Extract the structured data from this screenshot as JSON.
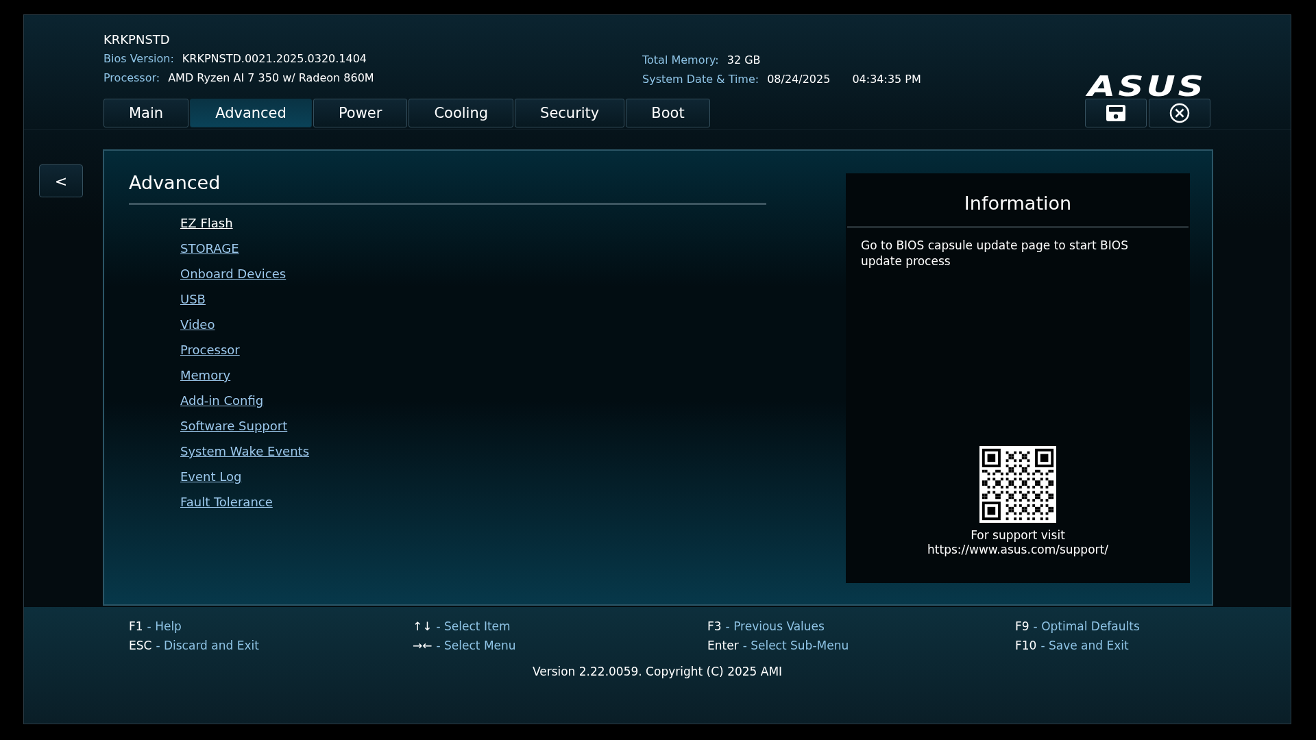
{
  "header": {
    "model": "KRKPNSTD",
    "info_left": [
      {
        "label": "Bios Version:",
        "value": "KRKPNSTD.0021.2025.0320.1404"
      },
      {
        "label": "Processor:",
        "value": "AMD Ryzen AI 7 350 w/ Radeon 860M"
      }
    ],
    "total_memory": {
      "label": "Total Memory:",
      "value": "32 GB"
    },
    "date_time": {
      "label": "System Date & Time:",
      "date": "08/24/2025",
      "time": "04:34:35 PM"
    },
    "logo_text": "ASUS"
  },
  "tabs": [
    {
      "label": "Main",
      "selected": false
    },
    {
      "label": "Advanced",
      "selected": true
    },
    {
      "label": "Power",
      "selected": false
    },
    {
      "label": "Cooling",
      "selected": false
    },
    {
      "label": "Security",
      "selected": false
    },
    {
      "label": "Boot",
      "selected": false
    }
  ],
  "back_button": "<",
  "page": {
    "title": "Advanced",
    "items": [
      {
        "label": "EZ Flash",
        "selected": true
      },
      {
        "label": "STORAGE",
        "selected": false
      },
      {
        "label": "Onboard Devices",
        "selected": false
      },
      {
        "label": "USB",
        "selected": false
      },
      {
        "label": "Video",
        "selected": false
      },
      {
        "label": "Processor",
        "selected": false
      },
      {
        "label": "Memory",
        "selected": false
      },
      {
        "label": "Add-in Config",
        "selected": false
      },
      {
        "label": "Software Support",
        "selected": false
      },
      {
        "label": "System Wake Events",
        "selected": false
      },
      {
        "label": "Event Log",
        "selected": false
      },
      {
        "label": "Fault Tolerance",
        "selected": false
      }
    ]
  },
  "information": {
    "title": "Information",
    "text": "Go to BIOS capsule update page to start BIOS update process",
    "support_lines": [
      "For support visit",
      "https://www.asus.com/support/"
    ]
  },
  "footer": {
    "hints": [
      {
        "key": "F1",
        "action": "- Help"
      },
      {
        "key": "ESC",
        "action": "- Discard and Exit"
      },
      {
        "key": "↑↓",
        "action": "- Select Item"
      },
      {
        "key": "→←",
        "action": "- Select Menu"
      },
      {
        "key": "F3",
        "action": "- Previous Values"
      },
      {
        "key": "Enter",
        "action": "- Select Sub-Menu"
      },
      {
        "key": "F9",
        "action": "- Optimal Defaults"
      },
      {
        "key": "F10",
        "action": "- Save and Exit"
      }
    ],
    "version": "Version 2.22.0059. Copyright (C) 2025 AMI"
  }
}
